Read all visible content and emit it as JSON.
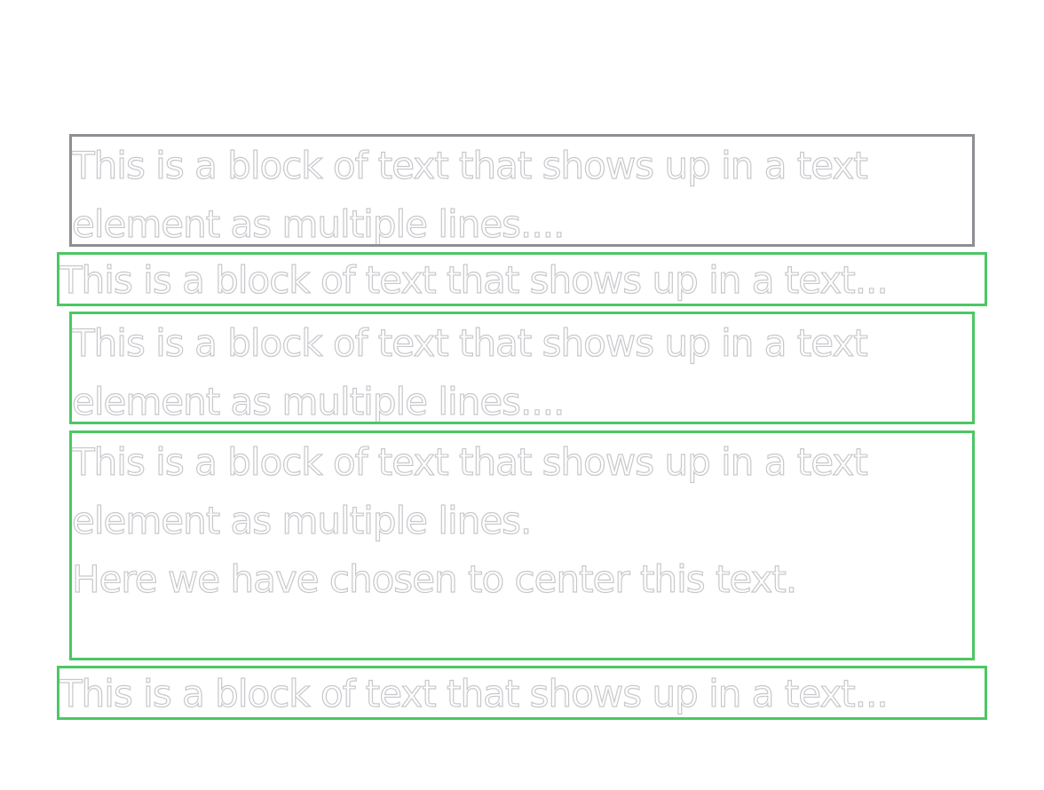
{
  "blocks": [
    {
      "lines": [
        "This is a block of text that shows up in a text",
        "element as multiple lines...."
      ],
      "border": "gray"
    },
    {
      "lines": [
        "This is a block of text that shows up in a text..."
      ],
      "border": "green"
    },
    {
      "lines": [
        "This is a block of text that shows up in a text",
        "element as multiple lines...."
      ],
      "border": "green"
    },
    {
      "lines": [
        "This is a block of text that shows up in a text",
        "element as multiple lines.",
        "Here we have chosen to center this text."
      ],
      "border": "green"
    },
    {
      "lines": [
        "This is a block of text that shows up in a text..."
      ],
      "border": "green"
    }
  ],
  "colors": {
    "gray_border": "#8e8e93",
    "green_border": "#4cc764",
    "text_outline": "#c8c8cc",
    "background": "#ffffff"
  }
}
